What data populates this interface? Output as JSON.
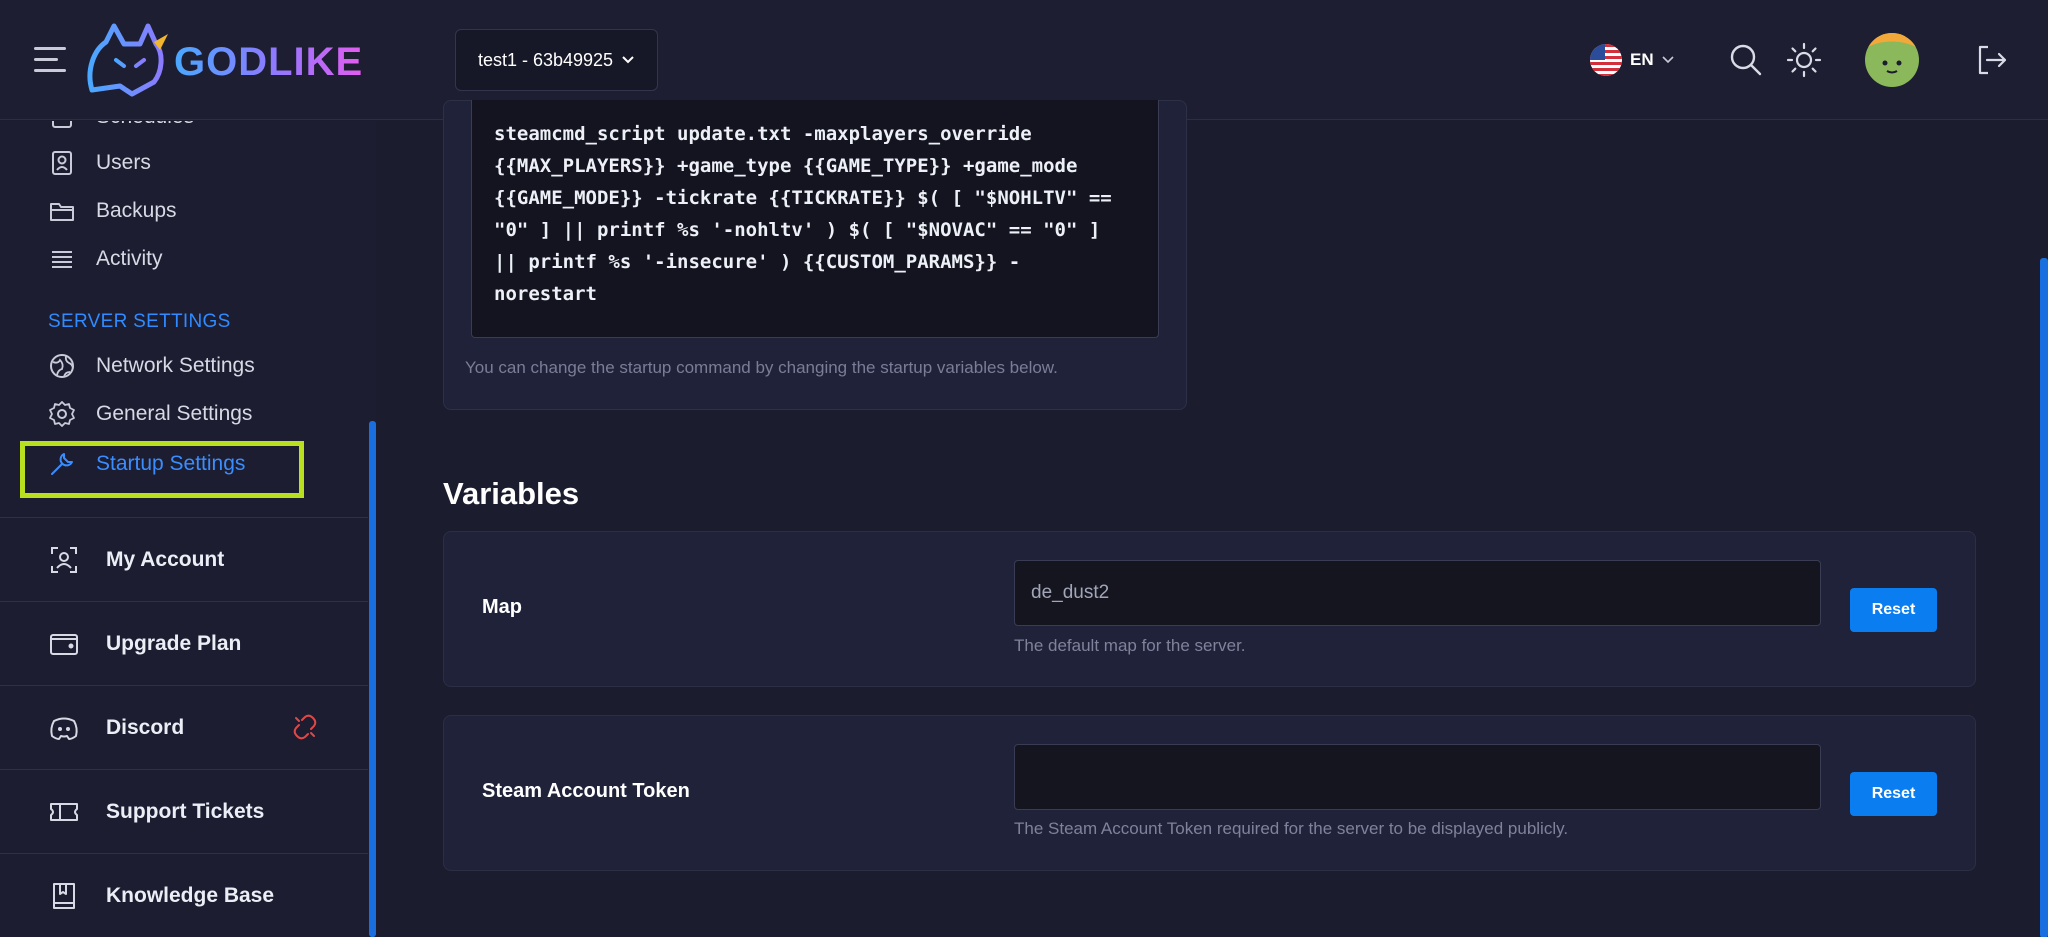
{
  "header": {
    "logo_text": "GODLIKE",
    "server_selector": "test1 - 63b49925",
    "language": "EN"
  },
  "sidebar": {
    "items_top": [
      {
        "label": "Schedules",
        "icon": "calendar-icon"
      },
      {
        "label": "Users",
        "icon": "user-badge-icon"
      },
      {
        "label": "Backups",
        "icon": "folder-icon"
      },
      {
        "label": "Activity",
        "icon": "list-icon"
      }
    ],
    "section_title": "SERVER SETTINGS",
    "settings_items": [
      {
        "label": "Network Settings",
        "icon": "globe-icon"
      },
      {
        "label": "General Settings",
        "icon": "gear-icon"
      },
      {
        "label": "Startup Settings",
        "icon": "wrench-icon"
      }
    ],
    "blocks": [
      {
        "label": "My Account",
        "icon": "account-icon"
      },
      {
        "label": "Upgrade Plan",
        "icon": "wallet-icon"
      },
      {
        "label": "Discord",
        "icon": "discord-icon"
      },
      {
        "label": "Support Tickets",
        "icon": "ticket-icon"
      },
      {
        "label": "Knowledge Base",
        "icon": "book-icon"
      }
    ]
  },
  "startup": {
    "command": "steamcmd_script update.txt -maxplayers_override\n{{MAX_PLAYERS}} +game_type {{GAME_TYPE}} +game_mode\n{{GAME_MODE}} -tickrate {{TICKRATE}} $( [ \"$NOHLTV\" ==\n\"0\" ] || printf %s '-nohltv' ) $( [ \"$NOVAC\" == \"0\" ]\n|| printf %s '-insecure' ) {{CUSTOM_PARAMS}} -\nnorestart",
    "hint": "You can change the startup command by changing the startup variables below."
  },
  "variables": {
    "title": "Variables",
    "items": [
      {
        "label": "Map",
        "value": "de_dust2",
        "description": "The default map for the server.",
        "reset_label": "Reset"
      },
      {
        "label": "Steam Account Token",
        "value": "",
        "description": "The Steam Account Token required for the server to be displayed publicly.",
        "reset_label": "Reset"
      }
    ]
  },
  "colors": {
    "accent": "#2f8bff",
    "highlight_box": "#b8e01f",
    "reset_button": "#0a7df0",
    "discord_link_icon": "#e04848"
  }
}
